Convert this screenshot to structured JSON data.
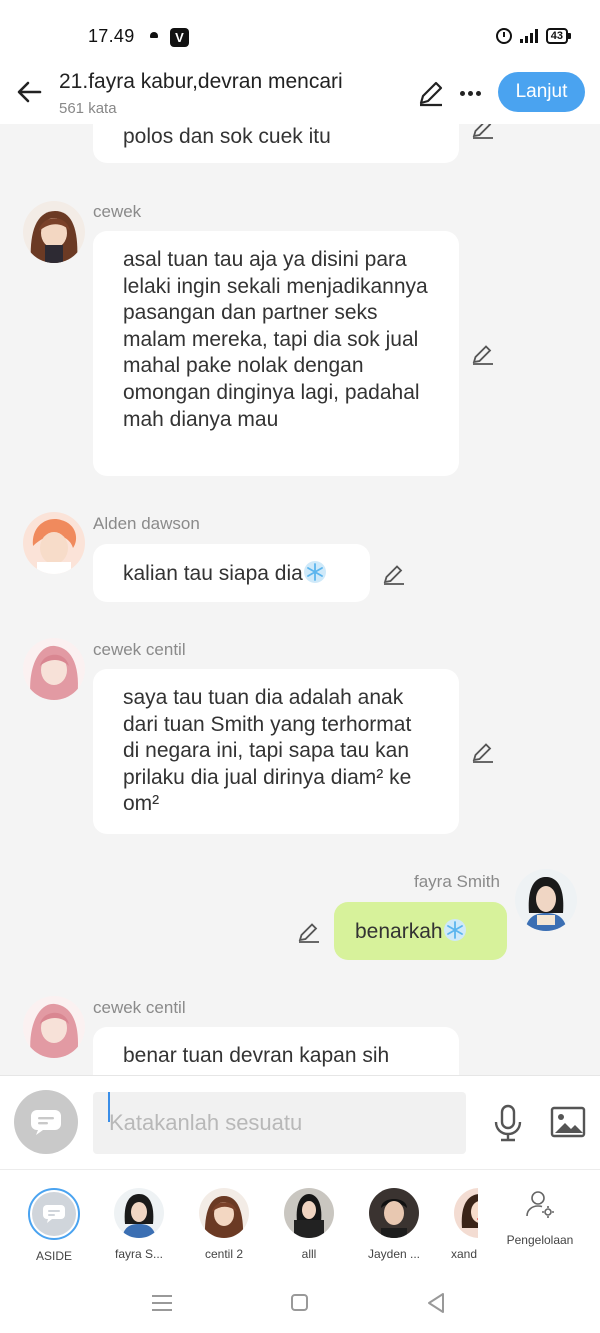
{
  "status_bar": {
    "time": "17.49",
    "app_badge": "V",
    "battery": "43"
  },
  "header": {
    "title": "21.fayra kabur,devran mencari",
    "word_count": "561 kata",
    "continue_label": "Lanjut"
  },
  "messages": [
    {
      "sender": "",
      "text": "polos dan sok cuek itu"
    },
    {
      "sender": "cewek",
      "text": "asal tuan tau aja ya disini para lelaki ingin sekali menjadikannya pasangan dan partner seks malam mereka, tapi dia sok jual mahal pake nolak dengan omongan dinginya lagi, padahal mah dianya mau"
    },
    {
      "sender": "Alden dawson",
      "text": "kalian tau siapa dia"
    },
    {
      "sender": "cewek centil",
      "text": "saya tau tuan dia adalah anak dari tuan Smith yang terhormat di negara ini, tapi sapa tau kan prilaku dia jual dirinya diam² ke om²"
    },
    {
      "sender": "fayra Smith",
      "text": "benarkah"
    },
    {
      "sender": "cewek centil",
      "text": "benar tuan devran kapan sih"
    }
  ],
  "input": {
    "placeholder": "Katakanlah sesuatu"
  },
  "characters": [
    {
      "label": "ASIDE"
    },
    {
      "label": "fayra S..."
    },
    {
      "label": "centil 2"
    },
    {
      "label": "alll"
    },
    {
      "label": "Jayden ..."
    },
    {
      "label": "xand"
    }
  ],
  "manage_label": "Pengelolaan",
  "colors": {
    "accent": "#4aa3f0",
    "my_bubble": "#d7f29b",
    "other_bubble": "#ffffff",
    "background": "#f4f4f4"
  },
  "icons": [
    "back-arrow-icon",
    "pencil-icon",
    "more-icon",
    "snowflake-icon",
    "chat-bubble-icon",
    "mic-icon",
    "image-icon",
    "person-settings-icon",
    "menu-icon",
    "home-icon",
    "back-triangle-icon"
  ]
}
